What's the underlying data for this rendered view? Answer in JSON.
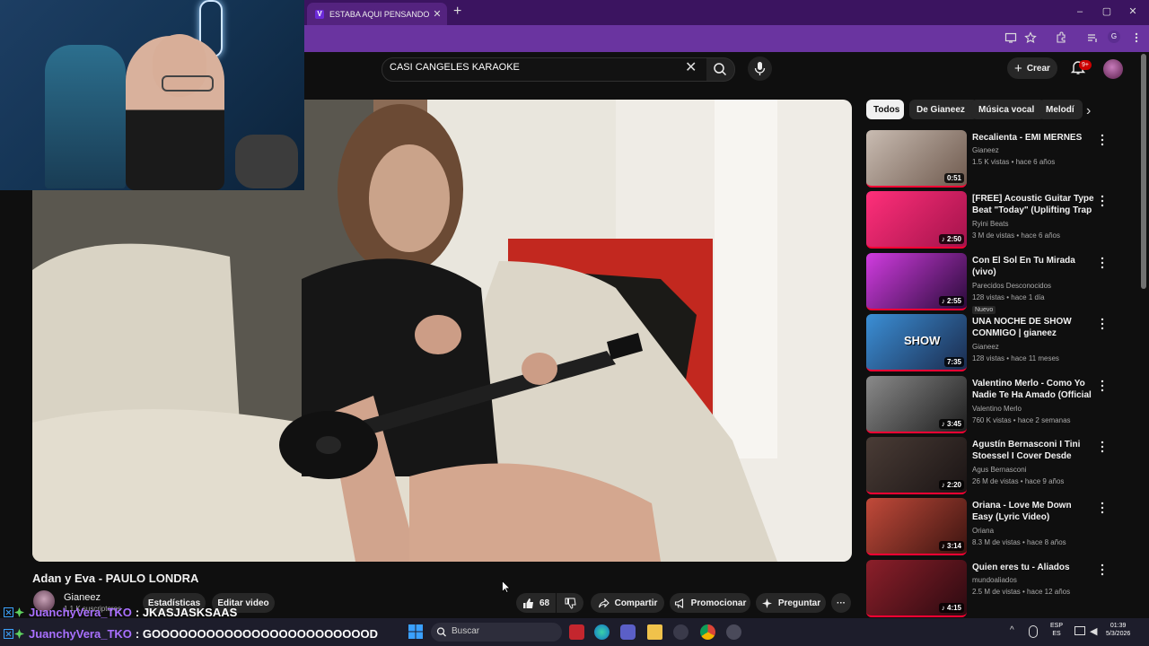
{
  "browser": {
    "tab_title": "ESTABA AQUI PENSANDO DESDE",
    "tab_close": "✕",
    "new_tab": "+",
    "window_controls": [
      "–",
      "▢",
      "✕"
    ],
    "profile_initial": "G"
  },
  "youtube": {
    "search_value": "CASI CANGELES KARAOKE",
    "clear_icon": "✕",
    "create_label": "Crear",
    "notifications_badge": "9+"
  },
  "video": {
    "title": "Adan y Eva - PAULO LONDRA",
    "channel_name": "Gianeez",
    "channel_subs": "1,1 K suscriptores",
    "stats_label": "Estadísticas",
    "edit_label": "Editar video",
    "like_count": "68",
    "share_label": "Compartir",
    "promote_label": "Promocionar",
    "ask_label": "Preguntar",
    "more_label": "···"
  },
  "chat": [
    {
      "user": "JuanchyVera_TKO",
      "message": ": JKASJASKSAAS"
    },
    {
      "user": "JuanchyVera_TKO",
      "message": ": GOOOOOOOOOOOOOOOOOOOOOOOOD"
    }
  ],
  "chips": [
    "Todos",
    "De Gianeez",
    "Música vocal",
    "Melodí"
  ],
  "chip_next": "›",
  "recommendations": [
    {
      "title": "Recalienta - EMI MERNES",
      "channel": "Gianeez",
      "meta": "1.5 K vistas • hace 6 años",
      "duration": "0:51",
      "color1": "#c9bcb2",
      "color2": "#6f5a4e"
    },
    {
      "title": "[FREE] Acoustic Guitar Type Beat \"Today\" (Uplifting Trap / ...",
      "channel": "Ryini Beats",
      "meta": "3 M de vistas • hace 6 años",
      "duration": "♪ 2:50",
      "color1": "#ff2f7a",
      "color2": "#a3134b"
    },
    {
      "title": "Con El Sol En Tu Mirada (vivo)",
      "channel": "Parecidos Desconocidos",
      "meta": "128 vistas • hace 1 día",
      "badge": "Nuevo",
      "duration": "♪ 2:55",
      "color1": "#d13ce0",
      "color2": "#2a0b3a"
    },
    {
      "title": "UNA NOCHE DE SHOW CONMIGO | gianeez",
      "channel": "Gianeez",
      "meta": "128 vistas • hace 11 meses",
      "duration": "7:35",
      "thumb_text": "SHOW",
      "color1": "#3b8fd6",
      "color2": "#1b2b4d"
    },
    {
      "title": "Valentino Merlo - Como Yo Nadie Te Ha Amado (Official ...",
      "channel": "Valentino Merlo",
      "meta": "760 K vistas • hace 2 semanas",
      "duration": "♪ 3:45",
      "color1": "#8a8a8a",
      "color2": "#1e1e1e"
    },
    {
      "title": "Agustín Bernasconi I Tini Stoessel I Cover Desde Cuando",
      "channel": "Agus Bernasconi",
      "meta": "26 M de vistas • hace 9 años",
      "duration": "♪ 2:20",
      "color1": "#4a3c36",
      "color2": "#1a1414"
    },
    {
      "title": "Oriana - Love Me Down Easy (Lyric Video)",
      "channel": "Oriana",
      "meta": "8.3 M de vistas • hace 8 años",
      "duration": "♪ 3:14",
      "color1": "#c24a3a",
      "color2": "#3b1410"
    },
    {
      "title": "Quien eres tu - Aliados",
      "channel": "mundoaliados",
      "meta": "2.5 M de vistas • hace 12 años",
      "duration": "♪ 4:15",
      "color1": "#8c1f2a",
      "color2": "#2b0a10"
    }
  ],
  "taskbar": {
    "search_placeholder": "Buscar",
    "lang_line1": "ESP",
    "lang_line2": "ES",
    "time": "01:39",
    "date": "5/3/2026"
  }
}
